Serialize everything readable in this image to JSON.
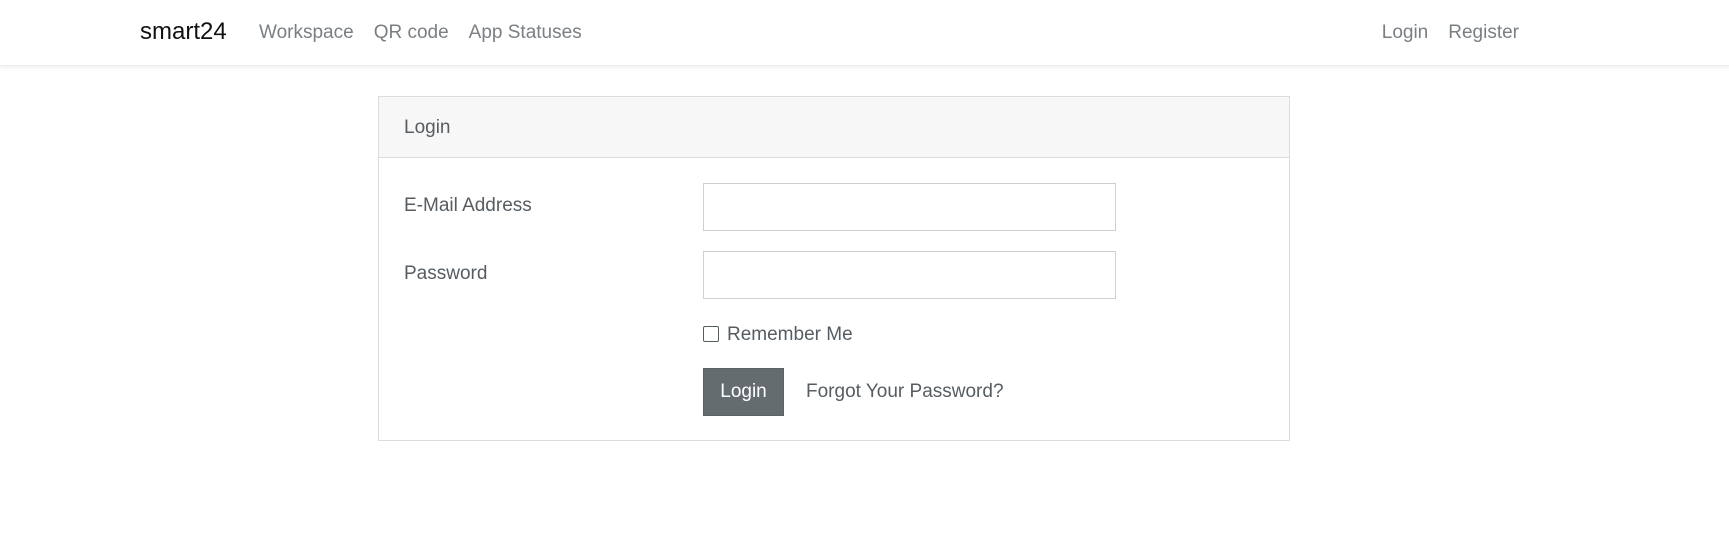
{
  "navbar": {
    "brand": "smart24",
    "left_links": [
      "Workspace",
      "QR code",
      "App Statuses"
    ],
    "right_links": [
      "Login",
      "Register"
    ]
  },
  "login_card": {
    "header": "Login",
    "email_label": "E-Mail Address",
    "email_value": "",
    "password_label": "Password",
    "password_value": "",
    "remember_label": "Remember Me",
    "remember_checked": false,
    "submit_label": "Login",
    "forgot_label": "Forgot Your Password?"
  },
  "colors": {
    "button_bg": "#646c70",
    "text": "#555d63",
    "nav_link": "#7a7f84",
    "header_bg": "#f7f7f7"
  }
}
